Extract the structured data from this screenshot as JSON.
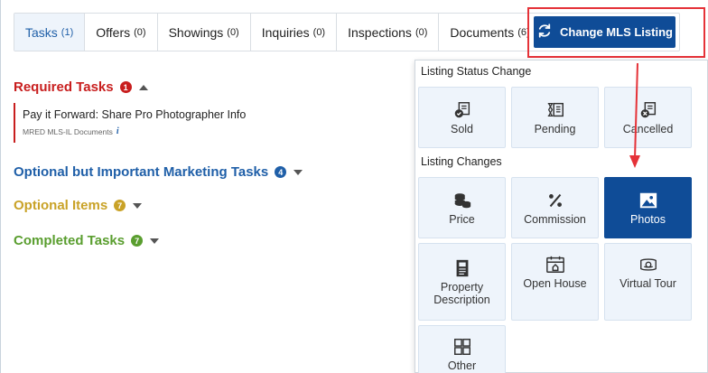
{
  "tabs": [
    {
      "label": "Tasks",
      "count": "(1)"
    },
    {
      "label": "Offers",
      "count": "(0)"
    },
    {
      "label": "Showings",
      "count": "(0)"
    },
    {
      "label": "Inquiries",
      "count": "(0)"
    },
    {
      "label": "Inspections",
      "count": "(0)"
    },
    {
      "label": "Documents",
      "count": "(6)"
    }
  ],
  "change_button": {
    "label": "Change MLS Listing"
  },
  "sections": {
    "required": {
      "label": "Required Tasks",
      "count": "1",
      "color": "#c81e1e"
    },
    "optional_important": {
      "label": "Optional but Important Marketing Tasks",
      "count": "4",
      "color": "#1f5fa8"
    },
    "optional_items": {
      "label": "Optional Items",
      "count": "7",
      "color": "#c9a227"
    },
    "completed": {
      "label": "Completed Tasks",
      "count": "7",
      "color": "#5a9e2f"
    }
  },
  "task": {
    "title": "Pay it Forward: Share Pro Photographer Info",
    "source": "MRED MLS-IL Documents",
    "info": "i"
  },
  "panel": {
    "status_title": "Listing Status Change",
    "status_items": [
      {
        "label": "Sold",
        "icon": "sold-icon"
      },
      {
        "label": "Pending",
        "icon": "pending-icon"
      },
      {
        "label": "Cancelled",
        "icon": "cancelled-icon"
      }
    ],
    "changes_title": "Listing Changes",
    "change_items": [
      {
        "label": "Price",
        "icon": "coins-icon"
      },
      {
        "label": "Commission",
        "icon": "percent-icon"
      },
      {
        "label": "Photos",
        "icon": "image-icon",
        "selected": true
      },
      {
        "label": "Property Description",
        "icon": "document-icon"
      },
      {
        "label": "Open House",
        "icon": "open-house-icon"
      },
      {
        "label": "Virtual Tour",
        "icon": "virtual-tour-icon"
      },
      {
        "label": "Other",
        "icon": "grid-icon"
      }
    ]
  },
  "colors": {
    "accent": "#0f4c97",
    "highlight": "#e53238",
    "tile_bg": "#eef4fb"
  }
}
